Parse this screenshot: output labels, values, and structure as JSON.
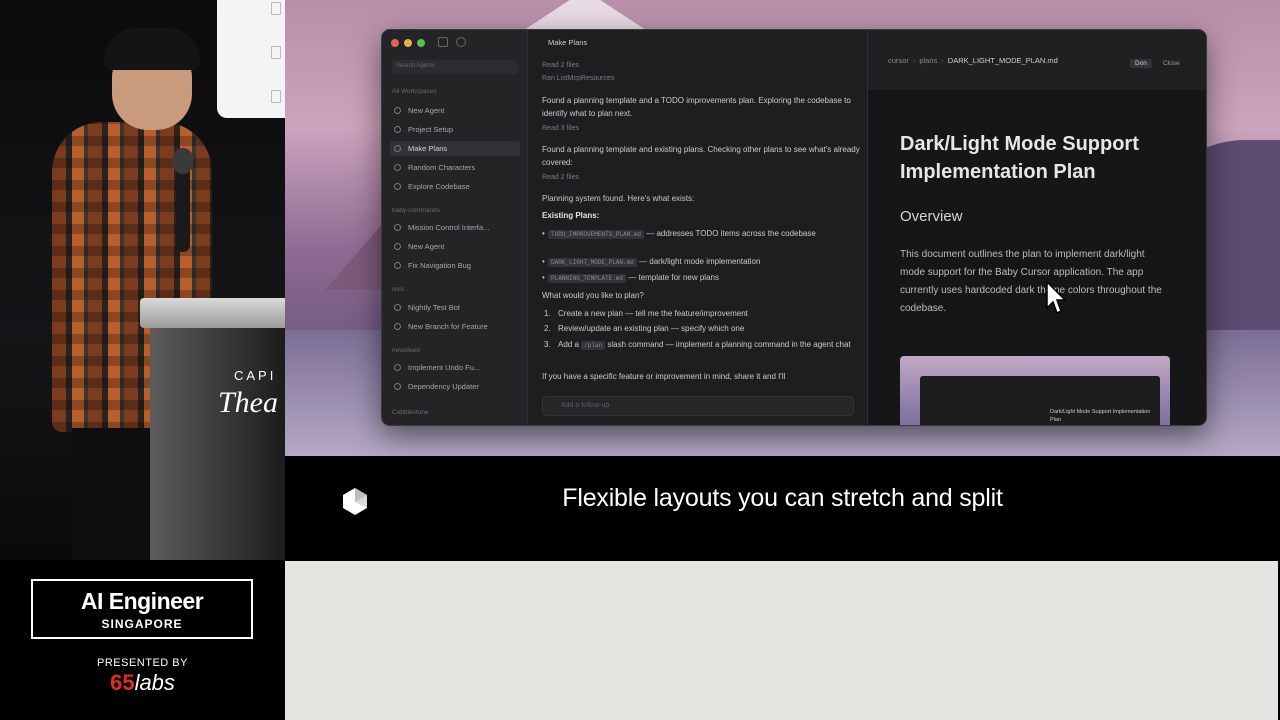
{
  "event": {
    "title": "AI Engineer",
    "subtitle": "SINGAPORE",
    "presented_by": "PRESENTED BY",
    "sponsor_num": "65",
    "sponsor_word": "labs"
  },
  "podium": {
    "line1": "CAPI",
    "line2": "Thea"
  },
  "caption": "Flexible layouts you can stretch and split",
  "app": {
    "search_placeholder": "Search Agents",
    "sidebar": {
      "sections": [
        "All Workspaces",
        "baby-commands",
        "recs",
        "newsfeed",
        "Cobblestone"
      ],
      "group1": [
        "New Agent",
        "Project Setup",
        "Make Plans",
        "Random Characters",
        "Explore Codebase"
      ],
      "group2": [
        "Mission Control Interfa...",
        "New Agent",
        "Fix Navigation Bug"
      ],
      "group3": [
        "Nightly Test Bot",
        "New Branch for Feature"
      ],
      "group4": [
        "Implement Undo Fu...",
        "Dependency Updater"
      ]
    },
    "chat": {
      "title": "Make Plans",
      "meta1": "Read 2 files",
      "meta2": "Ran ListMcpResources",
      "p1": "Found a planning template and a TODO improvements plan. Exploring the codebase to identify what to plan next.",
      "meta3": "Read 3 files",
      "p2": "Found a planning template and existing plans. Checking other plans to see what's already covered:",
      "meta4": "Read 2 files",
      "p3": "Planning system found. Here's what exists:",
      "existing": "Existing Plans:",
      "plans": [
        {
          "code": "TODO_IMPROVEMENTS_PLAN.md",
          "text": "— addresses TODO items across the codebase"
        },
        {
          "code": "DARK_LIGHT_MODE_PLAN.md",
          "text": "— dark/light mode implementation"
        },
        {
          "code": "PLANNING_TEMPLATE.md",
          "text": "— template for new plans"
        }
      ],
      "question": "What would you like to plan?",
      "options": [
        {
          "n": "1.",
          "text": "Create a new plan — tell me the feature/improvement"
        },
        {
          "n": "2.",
          "text": "Review/update an existing plan — specify which one"
        },
        {
          "n": "3.",
          "pre": "Add a",
          "code": "/plan",
          "text": "slash command — implement a planning command in the agent chat"
        }
      ],
      "closing": "If you have a specific feature or improvement in mind, share it and I'll",
      "input_placeholder": "Add a follow-up"
    },
    "editor": {
      "breadcrumb": [
        "cursor",
        "plans",
        "DARK_LIGHT_MODE_PLAN.md"
      ],
      "btn_done": "Don",
      "btn_close": "Close",
      "doc_title": "Dark/Light Mode Support Implementation Plan",
      "doc_h2": "Overview",
      "doc_body": "This document outlines the plan to implement dark/light mode support for the Baby Cursor application. The app currently uses hardcoded dark theme colors throughout the codebase.",
      "image_caption": "Dark/Light Mode Support Implementation Plan"
    }
  },
  "colors": {
    "accent_red": "#e32a2a",
    "chat_bg": "#1e1e21",
    "doc_bg": "#161618"
  }
}
